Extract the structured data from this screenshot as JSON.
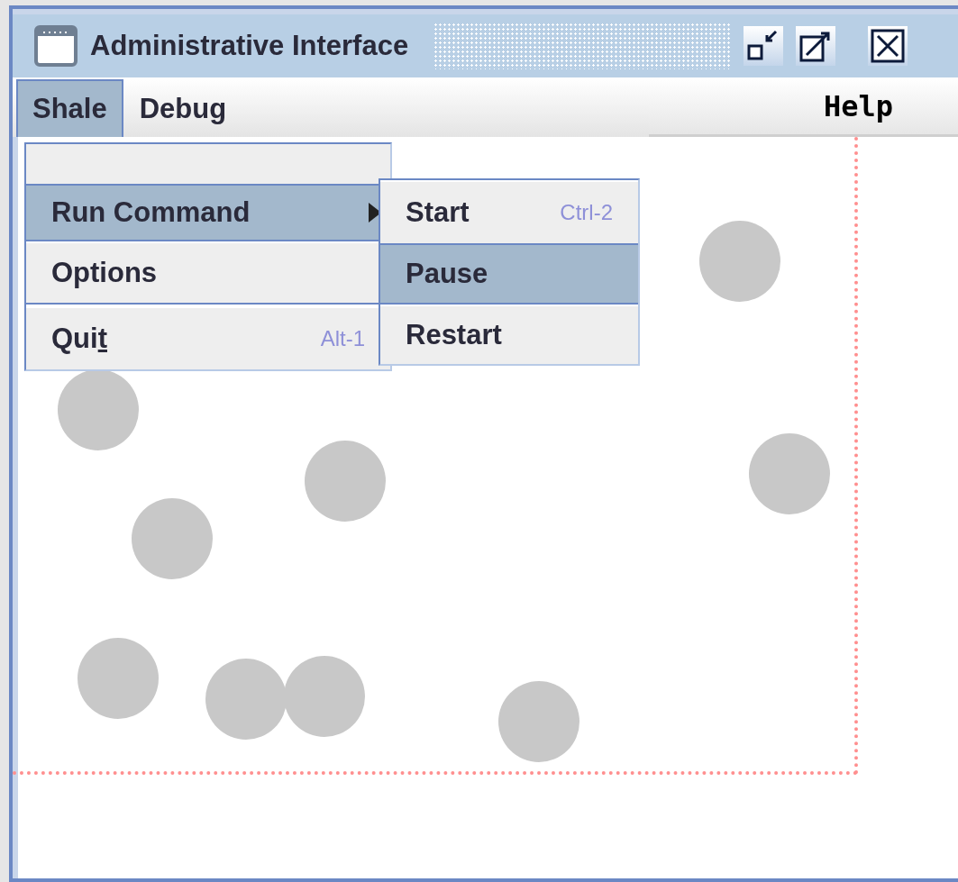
{
  "window": {
    "title": "Administrative Interface"
  },
  "menu_bar": {
    "menus": [
      {
        "label": "Shale",
        "selected": true
      },
      {
        "label": "Debug",
        "selected": false
      }
    ],
    "help": {
      "label": "Help"
    }
  },
  "open_menu": {
    "items": [
      {
        "kind": "blank"
      },
      {
        "kind": "submenu",
        "label": "Run Command",
        "selected": true
      },
      {
        "kind": "item",
        "label": "Options",
        "selected": false
      },
      {
        "kind": "separator"
      },
      {
        "kind": "item",
        "label": "Qui",
        "mnemonic": "t",
        "shortcut": "Alt-1",
        "selected": false
      }
    ]
  },
  "submenu": {
    "items": [
      {
        "label": "Start",
        "shortcut": "Ctrl-2",
        "selected": false
      },
      {
        "label": "Pause",
        "selected": true
      },
      {
        "label": "Restart",
        "selected": false
      }
    ]
  }
}
